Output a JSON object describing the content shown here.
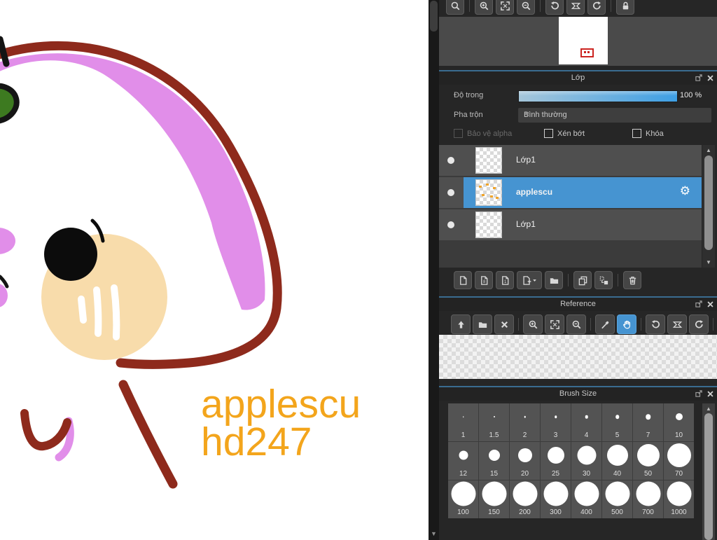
{
  "canvas": {
    "signature_line1": "applescu",
    "signature_line2": "hd247",
    "colors": {
      "outline_red": "#8e2a1c",
      "band_violet": "#e18ee9",
      "muzzle_peach": "#f8dcab",
      "leaf_green": "#3d7a20",
      "signature_orange": "#f3a51c"
    }
  },
  "navigator": {
    "tools": [
      "zoom-reset",
      "|",
      "zoom-in",
      "fit-screen",
      "zoom-out",
      "|",
      "rotate-ccw",
      "rotate-reset",
      "rotate-cw",
      "|",
      "lock"
    ]
  },
  "layer_panel": {
    "title": "Lớp",
    "opacity_label": "Độ trong",
    "opacity_value": "100 %",
    "blend_label": "Pha trộn",
    "blend_value": "Bình thường",
    "checkboxes": [
      {
        "label": "Bảo vệ alpha",
        "checked": false,
        "disabled": true
      },
      {
        "label": "Xén bớt",
        "checked": false,
        "disabled": false
      },
      {
        "label": "Khóa",
        "checked": false,
        "disabled": false
      }
    ],
    "layers": [
      {
        "name": "Lớp1",
        "selected": false,
        "thumb": "transparent"
      },
      {
        "name": "applescu",
        "selected": true,
        "thumb": "orange"
      },
      {
        "name": "Lớp1",
        "selected": false,
        "thumb": "transparent"
      }
    ],
    "toolbar": [
      "new-layer",
      "new-8bit-layer",
      "new-1bit-layer",
      "add-layer-menu",
      "new-folder",
      "|",
      "duplicate-layer",
      "merge-layer",
      "|",
      "delete-layer"
    ]
  },
  "reference_panel": {
    "title": "Reference",
    "tools": [
      "import-image",
      "open-folder",
      "clear",
      "|",
      "zoom-in",
      "fit-screen",
      "zoom-out",
      "|",
      "eyedropper",
      "hand",
      "|",
      "rotate-ccw",
      "rotate-reset",
      "rotate-cw",
      "|",
      "lock"
    ],
    "active_tool": "hand"
  },
  "brush_panel": {
    "title": "Brush Size",
    "brushes": [
      {
        "label": "1",
        "dot": 1.5
      },
      {
        "label": "1.5",
        "dot": 2
      },
      {
        "label": "2",
        "dot": 2.5
      },
      {
        "label": "3",
        "dot": 3.5
      },
      {
        "label": "4",
        "dot": 4.5
      },
      {
        "label": "5",
        "dot": 5.5
      },
      {
        "label": "7",
        "dot": 7.5
      },
      {
        "label": "10",
        "dot": 10
      },
      {
        "label": "12",
        "dot": 13
      },
      {
        "label": "15",
        "dot": 16
      },
      {
        "label": "20",
        "dot": 20
      },
      {
        "label": "25",
        "dot": 24
      },
      {
        "label": "30",
        "dot": 27
      },
      {
        "label": "40",
        "dot": 30
      },
      {
        "label": "50",
        "dot": 32
      },
      {
        "label": "70",
        "dot": 34
      },
      {
        "label": "100",
        "dot": 35
      },
      {
        "label": "150",
        "dot": 35
      },
      {
        "label": "200",
        "dot": 35
      },
      {
        "label": "300",
        "dot": 35
      },
      {
        "label": "400",
        "dot": 35
      },
      {
        "label": "500",
        "dot": 35
      },
      {
        "label": "700",
        "dot": 35
      },
      {
        "label": "1000",
        "dot": 35
      }
    ]
  },
  "accent": {
    "selection_blue": "#4694d1",
    "panel_border_blue": "#3a6c90"
  }
}
